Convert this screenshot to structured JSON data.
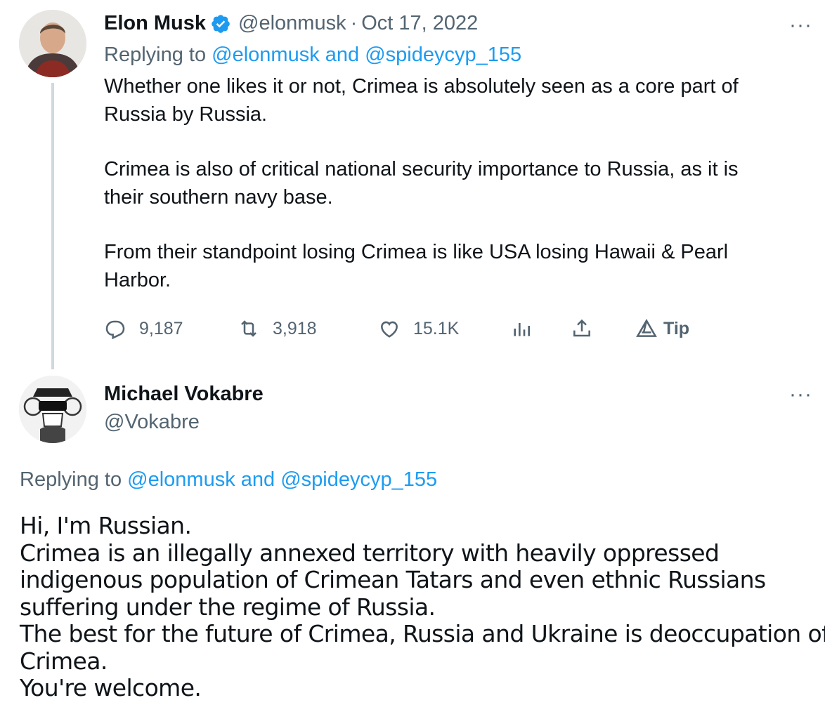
{
  "tweet": {
    "author_name": "Elon Musk",
    "verified": true,
    "handle": "@elonmusk",
    "separator": "·",
    "date": "Oct 17, 2022",
    "replying_prefix": "Replying to",
    "replying_mentions": "@elonmusk and @spideycyp_155",
    "paragraphs": [
      [
        "Whether one likes it or not, Crimea is absolutely seen as a core part of",
        "Russia by Russia."
      ],
      [
        "Crimea is also of critical national security importance to Russia, as it is",
        "their southern navy base."
      ],
      [
        "From their standpoint losing Crimea is like USA losing Hawaii & Pearl",
        "Harbor."
      ]
    ],
    "actions": {
      "replies": "9,187",
      "retweets": "3,918",
      "likes": "15.1K",
      "tip_label": "Tip"
    },
    "more_label": "···"
  },
  "reply": {
    "author_name": "Michael Vokabre",
    "handle": "@Vokabre",
    "replying_prefix": "Replying to",
    "replying_mentions": "@elonmusk and @spideycyp_155",
    "lines": [
      "Hi, I'm Russian.",
      "Crimea is an illegally annexed territory with heavily oppressed",
      "indigenous population of Crimean Tatars and even ethnic Russians",
      "suffering under the regime of Russia.",
      "The best for the future of Crimea, Russia and Ukraine is deoccupation of",
      "Crimea.",
      "You're welcome."
    ],
    "more_label": "···"
  },
  "colors": {
    "text": "#0f1419",
    "secondary": "#536471",
    "link": "#1d9bf0",
    "verified": "#1d9bf0",
    "thread_line": "#cfd9de"
  },
  "icons": [
    "verified-badge-icon",
    "reply-icon",
    "retweet-icon",
    "like-icon",
    "analytics-icon",
    "share-icon",
    "tip-icon",
    "more-icon"
  ]
}
